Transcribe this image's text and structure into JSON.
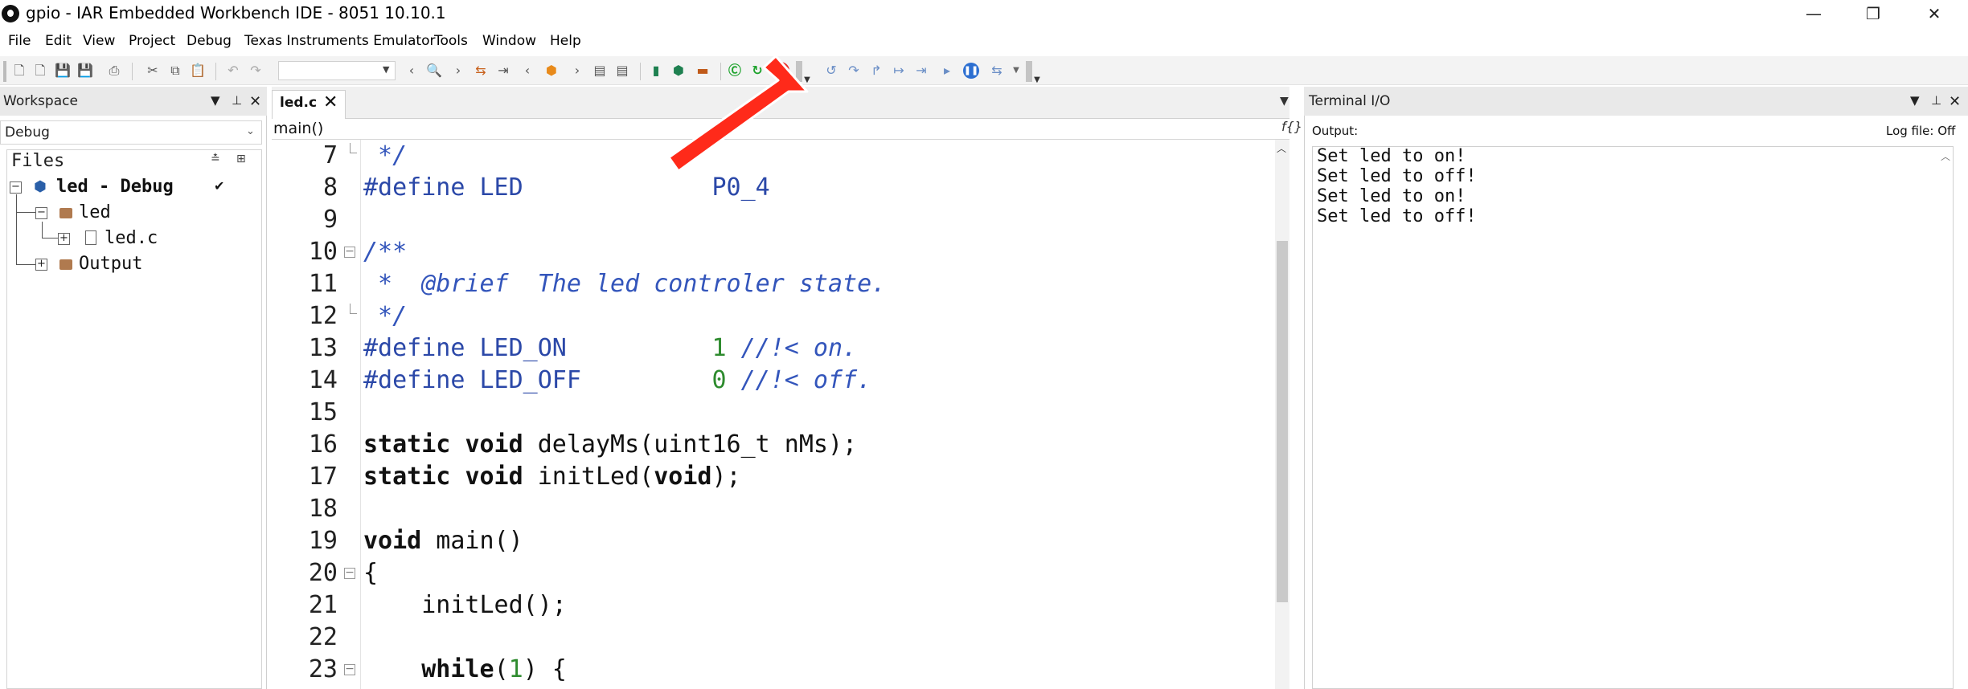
{
  "window": {
    "title": "gpio - IAR Embedded Workbench IDE - 8051 10.10.1",
    "minimize": "—",
    "maximize": "❐",
    "close": "✕"
  },
  "menu": [
    "File",
    "Edit",
    "View",
    "Project",
    "Debug",
    "Texas Instruments Emulator",
    "Tools",
    "Window",
    "Help"
  ],
  "workspace": {
    "title": "Workspace",
    "config": "Debug",
    "files_header": "Files",
    "tree": {
      "project": "led - Debug",
      "check": "✔",
      "folder1": "led",
      "file1": "led.c",
      "folder2": "Output"
    }
  },
  "editor": {
    "tab_label": "led.c",
    "tab_close": "✕",
    "function": "main()",
    "lines": [
      {
        "n": "7",
        "code": " */"
      },
      {
        "n": "8",
        "code": "#define LED             P0_4"
      },
      {
        "n": "9",
        "code": ""
      },
      {
        "n": "10",
        "code": "/**"
      },
      {
        "n": "11",
        "code": " *  @brief  The led controler state."
      },
      {
        "n": "12",
        "code": " */"
      },
      {
        "n": "13",
        "code": "#define LED_ON          1 //!< on."
      },
      {
        "n": "14",
        "code": "#define LED_OFF         0 //!< off."
      },
      {
        "n": "15",
        "code": ""
      },
      {
        "n": "16",
        "code": "static void delayMs(uint16_t nMs);"
      },
      {
        "n": "17",
        "code": "static void initLed(void);"
      },
      {
        "n": "18",
        "code": ""
      },
      {
        "n": "19",
        "code": "void main()"
      },
      {
        "n": "20",
        "code": "{"
      },
      {
        "n": "21",
        "code": "    initLed();"
      },
      {
        "n": "22",
        "code": ""
      },
      {
        "n": "23",
        "code": "    while(1) {"
      }
    ]
  },
  "terminal": {
    "title": "Terminal I/O",
    "output_label": "Output:",
    "log_label": "Log file: Off",
    "lines": [
      "Set led to on!",
      "Set led to off!",
      "Set led to on!",
      "Set led to off!"
    ]
  },
  "colors": {
    "comment": "#3355bb",
    "preprocessor": "#2b48a8",
    "number": "#2e8b2e",
    "annotation_arrow": "#ff2a1a",
    "stop_button": "#e8312a"
  }
}
